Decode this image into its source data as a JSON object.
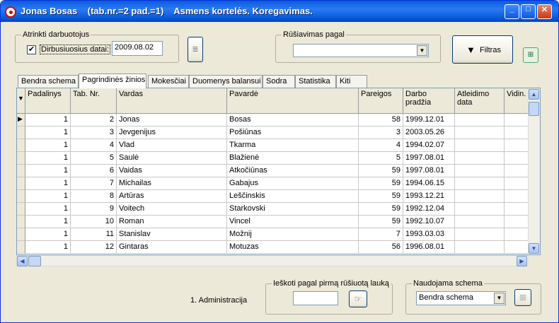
{
  "window": {
    "title": "Jonas Bosas    (tab.nr.=2 pad.=1)    Asmens kortelės. Koregavimas."
  },
  "filter_group": {
    "label": "Atrinkti darbuotojus",
    "checkbox_label": "Dirbusiuosius datai:",
    "date_value": "2009.08.02"
  },
  "sort_group": {
    "label": "Rūšiavimas pagal",
    "value": ""
  },
  "buttons": {
    "filter": "Filtras"
  },
  "tabs": [
    "Bendra schema",
    "Pagrindinės žinios",
    "Mokesčiai",
    "Duomenys balansui",
    "Sodra",
    "Statistika",
    "Kiti"
  ],
  "columns": [
    "Padalinys",
    "Tab. Nr.",
    "Vardas",
    "Pavardė",
    "Pareigos",
    "Darbo pradžia",
    "Atleidimo data",
    "Vidin."
  ],
  "rows": [
    {
      "pad": "1",
      "tab": "2",
      "vardas": "Jonas",
      "pavarde": "Bosas",
      "par": "58",
      "data": "1999.12.01"
    },
    {
      "pad": "1",
      "tab": "3",
      "vardas": " Jevgenijus",
      "pavarde": "Pošiūnas",
      "par": "3",
      "data": "2003.05.26"
    },
    {
      "pad": "1",
      "tab": "4",
      "vardas": "Vlad",
      "pavarde": "Tkarma",
      "par": "4",
      "data": "1994.02.07"
    },
    {
      "pad": "1",
      "tab": "5",
      "vardas": "Saulė",
      "pavarde": "Blažienė",
      "par": "5",
      "data": "1997.08.01"
    },
    {
      "pad": "1",
      "tab": "6",
      "vardas": "Vaidas",
      "pavarde": "Atkočiūnas",
      "par": "59",
      "data": "1997.08.01"
    },
    {
      "pad": "1",
      "tab": "7",
      "vardas": "Michailas",
      "pavarde": "Gabajus",
      "par": "59",
      "data": "1994.06.15"
    },
    {
      "pad": "1",
      "tab": "8",
      "vardas": "Artūras",
      "pavarde": "Leščinskis",
      "par": "59",
      "data": "1993.12.21"
    },
    {
      "pad": "1",
      "tab": "9",
      "vardas": "Voitech",
      "pavarde": "Starkovski",
      "par": "59",
      "data": "1992.12.04"
    },
    {
      "pad": "1",
      "tab": "10",
      "vardas": "Roman",
      "pavarde": "Vincel",
      "par": "59",
      "data": "1992.10.07"
    },
    {
      "pad": "1",
      "tab": "11",
      "vardas": "Stanislav",
      "pavarde": "Možnij",
      "par": "7",
      "data": "1993.03.03"
    },
    {
      "pad": "1",
      "tab": "12",
      "vardas": "Gintaras",
      "pavarde": "Motuzas",
      "par": "56",
      "data": "1996.08.01"
    }
  ],
  "status": {
    "department": "1. Administracija"
  },
  "search_group": {
    "label": "Ieškoti pagal pirmą rūšiuotą lauką",
    "value": ""
  },
  "schema_group": {
    "label": "Naudojama schema",
    "value": "Bendra schema"
  }
}
